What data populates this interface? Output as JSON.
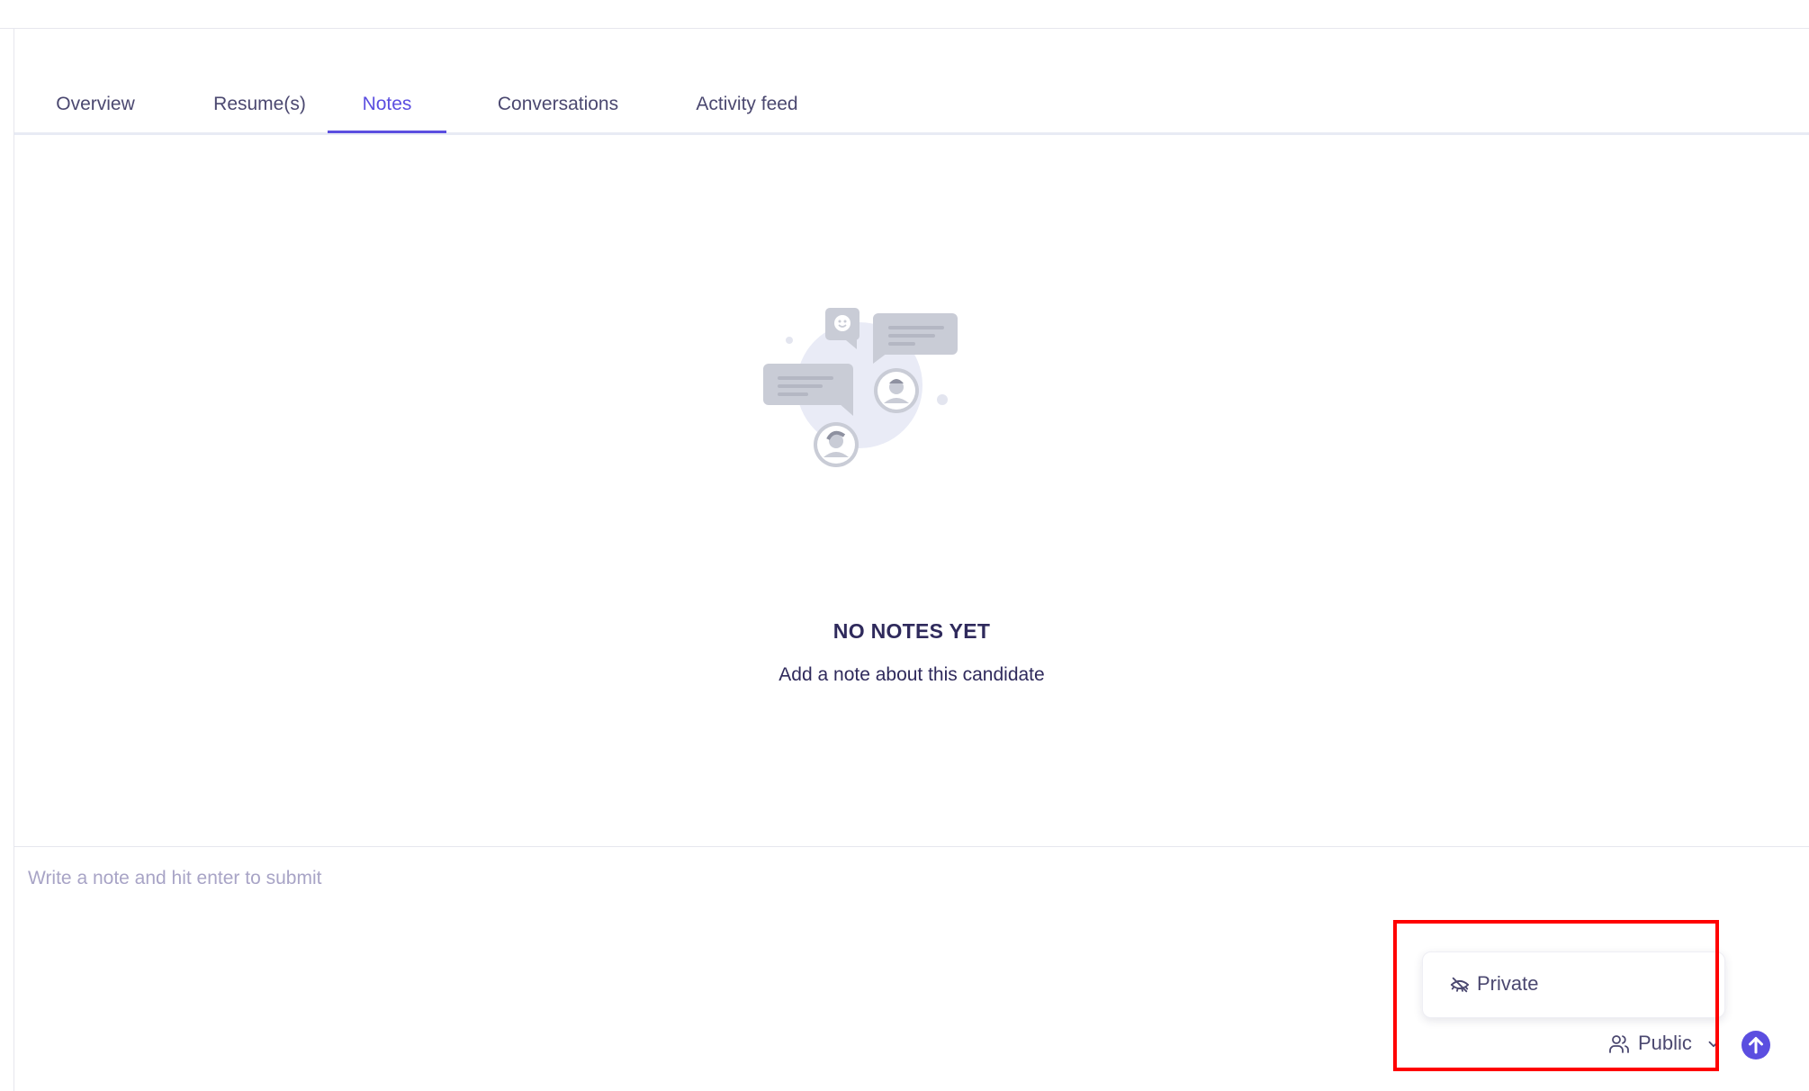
{
  "tabs": [
    {
      "label": "Overview",
      "active": false
    },
    {
      "label": "Resume(s)",
      "active": false
    },
    {
      "label": "Notes",
      "active": true
    },
    {
      "label": "Conversations",
      "active": false
    },
    {
      "label": "Activity feed",
      "active": false
    }
  ],
  "empty_state": {
    "title": "NO NOTES YET",
    "subtitle": "Add a note about this candidate",
    "illustration_icon": "chat-bubbles-illustration-icon"
  },
  "composer": {
    "placeholder": "Write a note and hit enter to submit",
    "value": ""
  },
  "visibility": {
    "menu_option": {
      "label": "Private",
      "icon": "eye-off-icon"
    },
    "selected": {
      "label": "Public",
      "icon": "users-icon"
    },
    "dropdown_icon": "chevron-down-icon"
  },
  "submit": {
    "icon": "arrow-up-circle-icon"
  },
  "colors": {
    "accent": "#5b4ee0",
    "text_primary": "#2f2a5c",
    "text_secondary": "#4b4870",
    "placeholder": "#a8a4c6",
    "highlight": "#ff0000"
  }
}
